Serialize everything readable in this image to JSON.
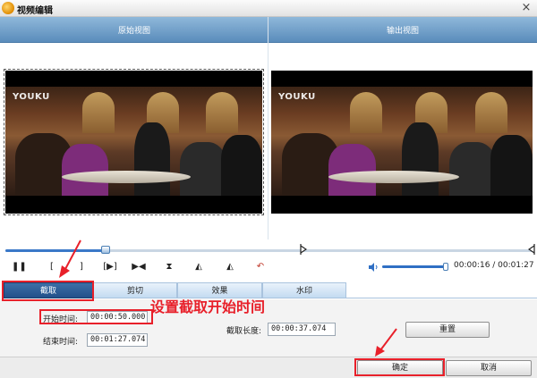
{
  "window": {
    "title": "视频编辑",
    "close_glyph": "×"
  },
  "panels": {
    "source_title": "原始视图",
    "output_title": "输出视图"
  },
  "preview": {
    "logo_left": "YOUKU",
    "logo_right": "YOUKU"
  },
  "timeline": {
    "progress": 0.19
  },
  "controls": {
    "play_pause": "❚❚",
    "mark_in": "[",
    "mark_out": "]",
    "next_frame": "[▶]",
    "skip": "▶◀",
    "flip_v": "⧗",
    "rotate_l": "◭",
    "rotate_r": "◭",
    "undo": "↶"
  },
  "volume": {
    "level": 0.96
  },
  "time_readout": "00:00:16 / 00:01:27",
  "tabs": [
    {
      "label": "截取",
      "active": true
    },
    {
      "label": "剪切",
      "active": false
    },
    {
      "label": "效果",
      "active": false
    },
    {
      "label": "水印",
      "active": false
    }
  ],
  "form": {
    "start_label": "开始时间:",
    "start_value": "00:00:50.000",
    "end_label": "结束时间:",
    "end_value": "00:01:27.074",
    "length_label": "截取长度:",
    "length_value": "00:00:37.074",
    "reset_label": "重置"
  },
  "annotation_text": "设置截取开始时间",
  "buttons": {
    "ok_label": "确定",
    "cancel_label": "取消"
  },
  "colors": {
    "accent": "#2f6fc4",
    "annotation": "#e8202a",
    "tab_active": "#2a5a94"
  },
  "icons": {
    "app": "app-logo-icon",
    "volume": "speaker-icon"
  }
}
